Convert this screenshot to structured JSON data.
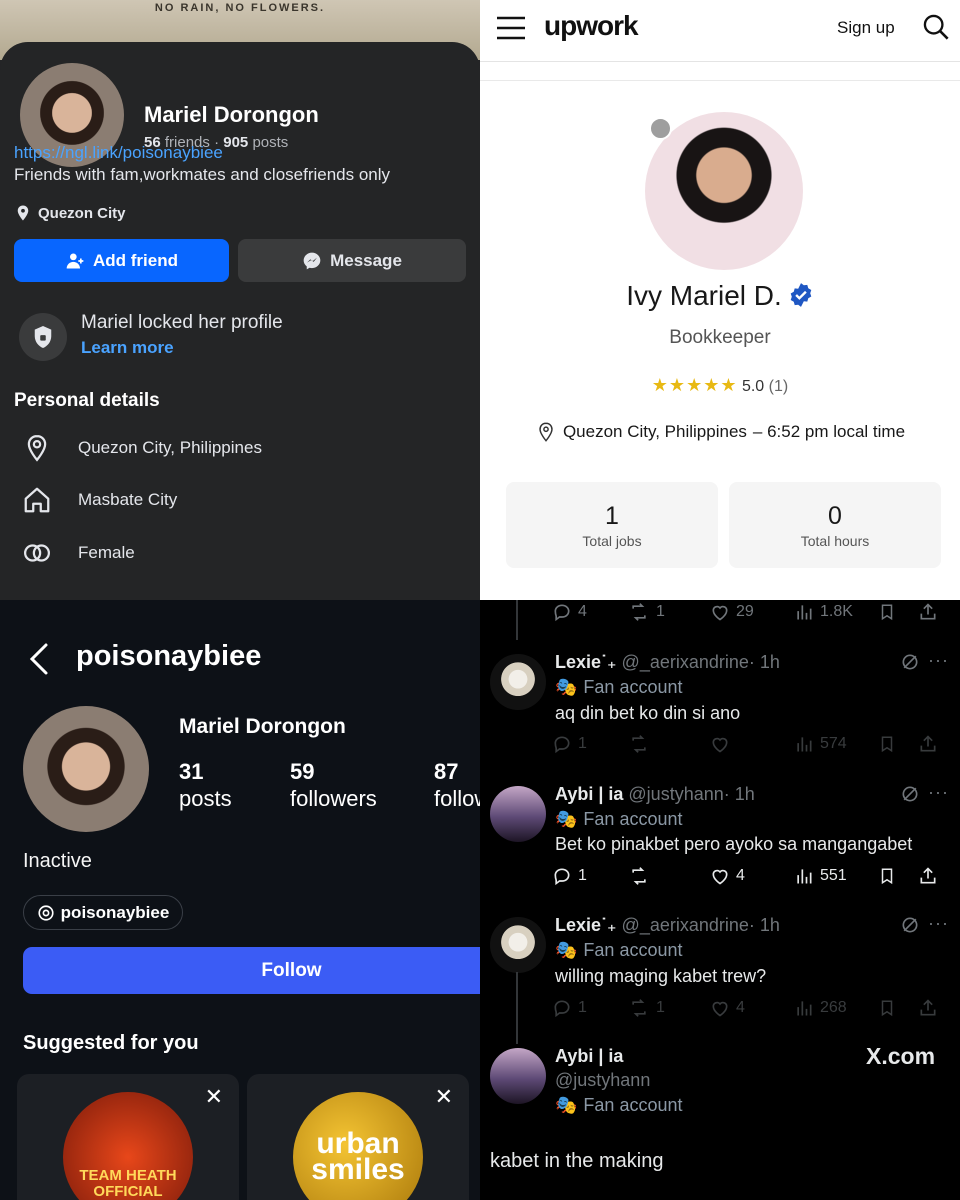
{
  "facebook": {
    "cover_text": "NO RAIN, NO FLOWERS.",
    "name": "Mariel Dorongon",
    "friends_count": "56",
    "friends_word": "friends",
    "separator": "·",
    "posts_count": "905",
    "posts_word": "posts",
    "link": "https://ngl.link/poisonaybiee",
    "bio": "Friends with fam,workmates and closefriends only",
    "location": "Quezon City",
    "add_friend_label": "Add friend",
    "message_label": "Message",
    "locked_text": "Mariel locked her profile",
    "learn_more": "Learn more",
    "personal_details_title": "Personal details",
    "details": [
      {
        "icon": "location-pin-icon",
        "text": "Quezon City, Philippines"
      },
      {
        "icon": "home-icon",
        "text": "Masbate City"
      },
      {
        "icon": "gender-icon",
        "text": "Female"
      }
    ],
    "accent": "#0866ff"
  },
  "upwork": {
    "logo": "upwork",
    "sign_up": "Sign up",
    "name": "Ivy Mariel D.",
    "title": "Bookkeeper",
    "stars": "★★★★★",
    "rating": "5.0",
    "rating_count": "(1)",
    "location": "Quezon City, Philippines",
    "local_time": "– 6:52 pm local time",
    "stats": [
      {
        "value": "1",
        "label": "Total jobs"
      },
      {
        "value": "0",
        "label": "Total hours"
      }
    ],
    "verified_color": "#1f57c3"
  },
  "instagram": {
    "username": "poisonaybiee",
    "name": "Mariel Dorongon",
    "posts_value": "31",
    "posts_label": "posts",
    "followers_value": "59",
    "followers_label": "followers",
    "following_value": "87",
    "following_label": "following",
    "bio": "Inactive",
    "threads_handle": "poisonaybiee",
    "follow_label": "Follow",
    "suggested_title": "Suggested for you",
    "suggestions": [
      {
        "logo_text": "TEAM HEATH OFFICIAL"
      },
      {
        "logo_text": "urban smiles"
      }
    ],
    "follow_color": "#3b5cf5"
  },
  "x": {
    "top_actions": {
      "replies": "4",
      "reposts": "1",
      "likes": "29",
      "views": "1.8K"
    },
    "badge": "Fan account",
    "replies": [
      {
        "display_name": "Lexie˙₊",
        "handle": "@_aerixandrine",
        "time": "· 1h",
        "text": "aq din bet ko din si ano",
        "replies": "1",
        "reposts": "",
        "likes": "",
        "views": "574"
      },
      {
        "display_name": "Aybi | ia",
        "handle": "@justyhann",
        "time": "· 1h",
        "text": "Bet ko pinakbet pero ayoko sa mangangabet",
        "replies": "1",
        "reposts": "",
        "likes": "4",
        "views": "551"
      },
      {
        "display_name": "Lexie˙₊",
        "handle": "@_aerixandrine",
        "time": "· 1h",
        "text": "willing maging kabet trew?",
        "replies": "1",
        "reposts": "1",
        "likes": "4",
        "views": "268"
      }
    ],
    "last_post": {
      "display_name": "Aybi | ia",
      "handle": "@justyhann",
      "text": "kabet in the making"
    },
    "watermark": "X.com",
    "more": "···"
  }
}
